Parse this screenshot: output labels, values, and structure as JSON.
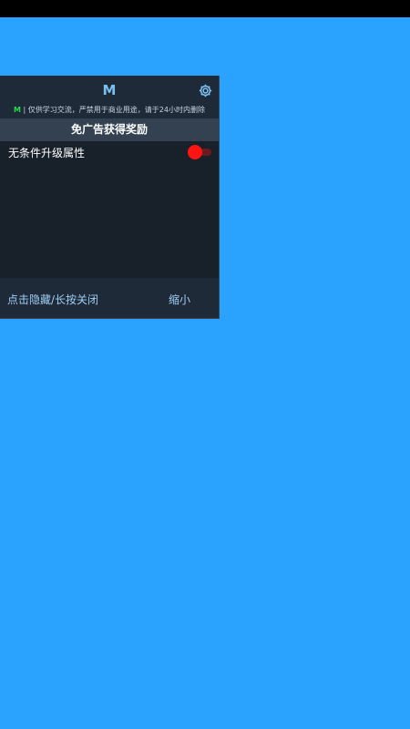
{
  "colors": {
    "background": "#29a3ff",
    "panel": "#182029",
    "header": "#1f2a38",
    "section_header": "#344150",
    "accent": "#7cc0f2",
    "brand_green": "#22e04a",
    "toggle_on": "#ff1414"
  },
  "panel": {
    "title": "M",
    "settings_icon": "gear-icon",
    "disclaimer": {
      "brand": "M",
      "separator": " | ",
      "text": "仅供学习交流，严禁用于商业用途，请于24小时内删除"
    },
    "section_title": "免广告获得奖励",
    "options": [
      {
        "label": "无条件升级属性",
        "enabled": true
      }
    ],
    "footer": {
      "hide_close": "点击隐藏/长按关闭",
      "minimize": "缩小"
    }
  }
}
